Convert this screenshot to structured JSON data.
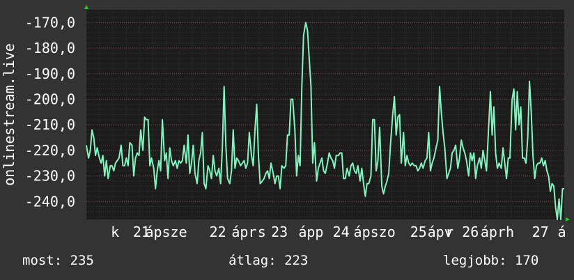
{
  "colors": {
    "background": "#333333",
    "plot_background": "#1c1c1c",
    "grid": "#5a4545",
    "line": "#7ff5c0",
    "text": "#ffffff",
    "arrow": "#22cc22"
  },
  "chart_data": {
    "type": "line",
    "ylabel": "onlinestream.live",
    "ylim": [
      -247,
      -165
    ],
    "yticks": [
      -170,
      -180,
      -190,
      -200,
      -210,
      -220,
      -230,
      -240
    ],
    "yticklabels": [
      "-170,0",
      "-180,0",
      "-190,0",
      "-200,0",
      "-210,0",
      "-220,0",
      "-230,0",
      "-240,0"
    ],
    "xlim": [
      0,
      100
    ],
    "xticklabels": [
      {
        "x": 6.0,
        "label": "k"
      },
      {
        "x": 11.5,
        "label": "21"
      },
      {
        "x": 16.7,
        "label": "ápsze"
      },
      {
        "x": 27.5,
        "label": "22"
      },
      {
        "x": 33.0,
        "label": "ápr"
      },
      {
        "x": 36.7,
        "label": "s"
      },
      {
        "x": 40.4,
        "label": "23"
      },
      {
        "x": 47.0,
        "label": "ápp"
      },
      {
        "x": 53.3,
        "label": "24"
      },
      {
        "x": 60.3,
        "label": "ápszo"
      },
      {
        "x": 69.5,
        "label": "25"
      },
      {
        "x": 74.0,
        "label": "ápv"
      },
      {
        "x": 78.6,
        "label": "r 26"
      },
      {
        "x": 86.0,
        "label": "áprh"
      },
      {
        "x": 95.0,
        "label": "27"
      },
      {
        "x": 99.5,
        "label": "á"
      }
    ],
    "series": [
      {
        "points": [
          [
            0.0,
            -218
          ],
          [
            0.5,
            -223
          ],
          [
            0.9,
            -220
          ],
          [
            1.3,
            -212
          ],
          [
            1.7,
            -215
          ],
          [
            2.1,
            -222
          ],
          [
            2.5,
            -219
          ],
          [
            3.0,
            -223
          ],
          [
            3.4,
            -225
          ],
          [
            3.8,
            -222
          ],
          [
            4.2,
            -230
          ],
          [
            4.6,
            -224
          ],
          [
            5.0,
            -231
          ],
          [
            5.5,
            -226
          ],
          [
            5.9,
            -226
          ],
          [
            6.3,
            -228
          ],
          [
            6.7,
            -225
          ],
          [
            7.1,
            -224
          ],
          [
            7.5,
            -223
          ],
          [
            8.0,
            -218
          ],
          [
            8.4,
            -226
          ],
          [
            8.8,
            -226
          ],
          [
            9.2,
            -223
          ],
          [
            9.6,
            -226
          ],
          [
            10.0,
            -217
          ],
          [
            10.5,
            -218
          ],
          [
            10.9,
            -230
          ],
          [
            11.3,
            -223
          ],
          [
            11.7,
            -221
          ],
          [
            12.1,
            -222
          ],
          [
            12.5,
            -212
          ],
          [
            13.0,
            -220
          ],
          [
            13.4,
            -207
          ],
          [
            13.8,
            -208
          ],
          [
            14.2,
            -208
          ],
          [
            14.6,
            -226
          ],
          [
            15.0,
            -223
          ],
          [
            15.5,
            -227
          ],
          [
            15.9,
            -235
          ],
          [
            16.3,
            -228
          ],
          [
            16.7,
            -224
          ],
          [
            17.1,
            -228
          ],
          [
            17.5,
            -208
          ],
          [
            18.0,
            -224
          ],
          [
            18.4,
            -221
          ],
          [
            18.8,
            -231
          ],
          [
            19.2,
            -219
          ],
          [
            19.6,
            -224
          ],
          [
            20.0,
            -226
          ],
          [
            20.5,
            -224
          ],
          [
            20.9,
            -227
          ],
          [
            21.3,
            -224
          ],
          [
            21.7,
            -225
          ],
          [
            22.1,
            -224
          ],
          [
            22.5,
            -218
          ],
          [
            23.0,
            -225
          ],
          [
            23.4,
            -214
          ],
          [
            23.8,
            -229
          ],
          [
            24.2,
            -225
          ],
          [
            24.6,
            -218
          ],
          [
            25.0,
            -229
          ],
          [
            25.5,
            -233
          ],
          [
            25.9,
            -224
          ],
          [
            26.3,
            -221
          ],
          [
            26.7,
            -213
          ],
          [
            27.1,
            -233
          ],
          [
            27.5,
            -235
          ],
          [
            28.0,
            -226
          ],
          [
            28.4,
            -228
          ],
          [
            28.8,
            -231
          ],
          [
            29.2,
            -222
          ],
          [
            29.6,
            -228
          ],
          [
            30.0,
            -230
          ],
          [
            30.5,
            -227
          ],
          [
            30.9,
            -233
          ],
          [
            31.3,
            -219
          ],
          [
            31.7,
            -195
          ],
          [
            32.1,
            -218
          ],
          [
            32.5,
            -231
          ],
          [
            33.0,
            -233
          ],
          [
            33.4,
            -228
          ],
          [
            33.8,
            -212
          ],
          [
            34.2,
            -227
          ],
          [
            34.6,
            -223
          ],
          [
            35.0,
            -224
          ],
          [
            35.5,
            -226
          ],
          [
            35.9,
            -225
          ],
          [
            36.3,
            -224
          ],
          [
            36.7,
            -227
          ],
          [
            37.1,
            -225
          ],
          [
            37.5,
            -213
          ],
          [
            38.0,
            -222
          ],
          [
            38.4,
            -226
          ],
          [
            38.8,
            -212
          ],
          [
            39.2,
            -202
          ],
          [
            39.6,
            -222
          ],
          [
            40.0,
            -233
          ],
          [
            40.5,
            -232
          ],
          [
            40.9,
            -231
          ],
          [
            41.3,
            -229
          ],
          [
            41.7,
            -228
          ],
          [
            42.1,
            -231
          ],
          [
            42.5,
            -225
          ],
          [
            43.0,
            -229
          ],
          [
            43.4,
            -233
          ],
          [
            43.8,
            -230
          ],
          [
            44.2,
            -230
          ],
          [
            44.6,
            -235
          ],
          [
            45.0,
            -226
          ],
          [
            45.5,
            -227
          ],
          [
            45.9,
            -226
          ],
          [
            46.3,
            -214
          ],
          [
            46.7,
            -214
          ],
          [
            47.1,
            -200
          ],
          [
            47.5,
            -200
          ],
          [
            48.0,
            -212
          ],
          [
            48.4,
            -230
          ],
          [
            48.8,
            -222
          ],
          [
            49.2,
            -226
          ],
          [
            49.6,
            -195
          ],
          [
            50.0,
            -175
          ],
          [
            50.5,
            -170
          ],
          [
            50.9,
            -173
          ],
          [
            51.3,
            -184
          ],
          [
            51.7,
            -195
          ],
          [
            52.1,
            -225
          ],
          [
            52.5,
            -217
          ],
          [
            53.0,
            -232
          ],
          [
            53.4,
            -227
          ],
          [
            53.8,
            -225
          ],
          [
            54.2,
            -223
          ],
          [
            54.6,
            -228
          ],
          [
            55.0,
            -229
          ],
          [
            55.5,
            -225
          ],
          [
            55.9,
            -221
          ],
          [
            56.3,
            -223
          ],
          [
            56.7,
            -224
          ],
          [
            57.1,
            -227
          ],
          [
            57.5,
            -222
          ],
          [
            58.0,
            -222
          ],
          [
            58.4,
            -221
          ],
          [
            58.8,
            -221
          ],
          [
            59.2,
            -231
          ],
          [
            59.6,
            -231
          ],
          [
            60.0,
            -227
          ],
          [
            60.5,
            -230
          ],
          [
            60.9,
            -226
          ],
          [
            61.3,
            -225
          ],
          [
            61.7,
            -228
          ],
          [
            62.1,
            -229
          ],
          [
            62.5,
            -226
          ],
          [
            63.0,
            -232
          ],
          [
            63.4,
            -227
          ],
          [
            63.8,
            -233
          ],
          [
            64.2,
            -238
          ],
          [
            64.6,
            -233
          ],
          [
            65.0,
            -233
          ],
          [
            65.5,
            -230
          ],
          [
            65.9,
            -208
          ],
          [
            66.3,
            -208
          ],
          [
            66.7,
            -228
          ],
          [
            67.1,
            -224
          ],
          [
            67.5,
            -211
          ],
          [
            68.0,
            -234
          ],
          [
            68.4,
            -237
          ],
          [
            68.8,
            -234
          ],
          [
            69.2,
            -232
          ],
          [
            69.6,
            -229
          ],
          [
            70.0,
            -218
          ],
          [
            70.5,
            -206
          ],
          [
            70.9,
            -199
          ],
          [
            71.3,
            -214
          ],
          [
            71.7,
            -207
          ],
          [
            72.1,
            -206
          ],
          [
            72.5,
            -225
          ],
          [
            73.0,
            -213
          ],
          [
            73.4,
            -226
          ],
          [
            73.8,
            -222
          ],
          [
            74.2,
            -225
          ],
          [
            74.6,
            -226
          ],
          [
            75.0,
            -225
          ],
          [
            75.5,
            -226
          ],
          [
            75.9,
            -226
          ],
          [
            76.3,
            -228
          ],
          [
            76.7,
            -227
          ],
          [
            77.1,
            -225
          ],
          [
            77.5,
            -227
          ],
          [
            78.0,
            -224
          ],
          [
            78.4,
            -223
          ],
          [
            78.8,
            -213
          ],
          [
            79.2,
            -228
          ],
          [
            79.6,
            -225
          ],
          [
            80.0,
            -223
          ],
          [
            80.5,
            -219
          ],
          [
            80.9,
            -216
          ],
          [
            81.3,
            -195
          ],
          [
            81.7,
            -205
          ],
          [
            82.1,
            -213
          ],
          [
            82.5,
            -219
          ],
          [
            83.0,
            -231
          ],
          [
            83.4,
            -229
          ],
          [
            83.8,
            -227
          ],
          [
            84.2,
            -221
          ],
          [
            84.6,
            -220
          ],
          [
            85.0,
            -218
          ],
          [
            85.5,
            -227
          ],
          [
            85.9,
            -223
          ],
          [
            86.3,
            -216
          ],
          [
            86.7,
            -219
          ],
          [
            87.1,
            -221
          ],
          [
            87.5,
            -224
          ],
          [
            88.0,
            -230
          ],
          [
            88.4,
            -221
          ],
          [
            88.8,
            -224
          ],
          [
            89.2,
            -221
          ],
          [
            89.6,
            -231
          ],
          [
            90.0,
            -226
          ],
          [
            90.5,
            -223
          ],
          [
            90.9,
            -227
          ],
          [
            91.3,
            -220
          ],
          [
            91.7,
            -224
          ],
          [
            92.1,
            -228
          ],
          [
            92.5,
            -214
          ],
          [
            93.0,
            -197
          ],
          [
            93.4,
            -214
          ],
          [
            93.8,
            -203
          ],
          [
            94.2,
            -221
          ],
          [
            94.6,
            -227
          ],
          [
            95.0,
            -225
          ],
          [
            95.5,
            -227
          ],
          [
            95.9,
            -219
          ],
          [
            96.3,
            -225
          ],
          [
            96.7,
            -231
          ],
          [
            97.1,
            -223
          ],
          [
            97.5,
            -223
          ],
          [
            98.0,
            -200
          ],
          [
            98.4,
            -196
          ],
          [
            98.8,
            -212
          ],
          [
            99.2,
            -197
          ],
          [
            99.6,
            -210
          ],
          [
            100.0,
            -203
          ],
          [
            100.4,
            -223
          ],
          [
            100.8,
            -223
          ],
          [
            101.2,
            -225
          ],
          [
            101.6,
            -215
          ],
          [
            102.0,
            -193
          ],
          [
            102.4,
            -205
          ],
          [
            102.8,
            -222
          ],
          [
            103.2,
            -231
          ],
          [
            103.6,
            -226
          ],
          [
            104.0,
            -225
          ],
          [
            104.4,
            -225
          ],
          [
            104.8,
            -223
          ],
          [
            105.2,
            -226
          ],
          [
            105.6,
            -224
          ],
          [
            106.0,
            -228
          ],
          [
            106.4,
            -230
          ],
          [
            106.8,
            -236
          ],
          [
            107.2,
            -233
          ],
          [
            107.6,
            -234
          ],
          [
            108.0,
            -242
          ],
          [
            108.4,
            -247
          ],
          [
            108.8,
            -239
          ],
          [
            109.2,
            -247
          ],
          [
            109.6,
            -235
          ],
          [
            110.0,
            -235
          ]
        ]
      }
    ]
  },
  "stats": {
    "now": "most: 235",
    "avg": "átlag: 223",
    "best": "legjobb: 170"
  }
}
